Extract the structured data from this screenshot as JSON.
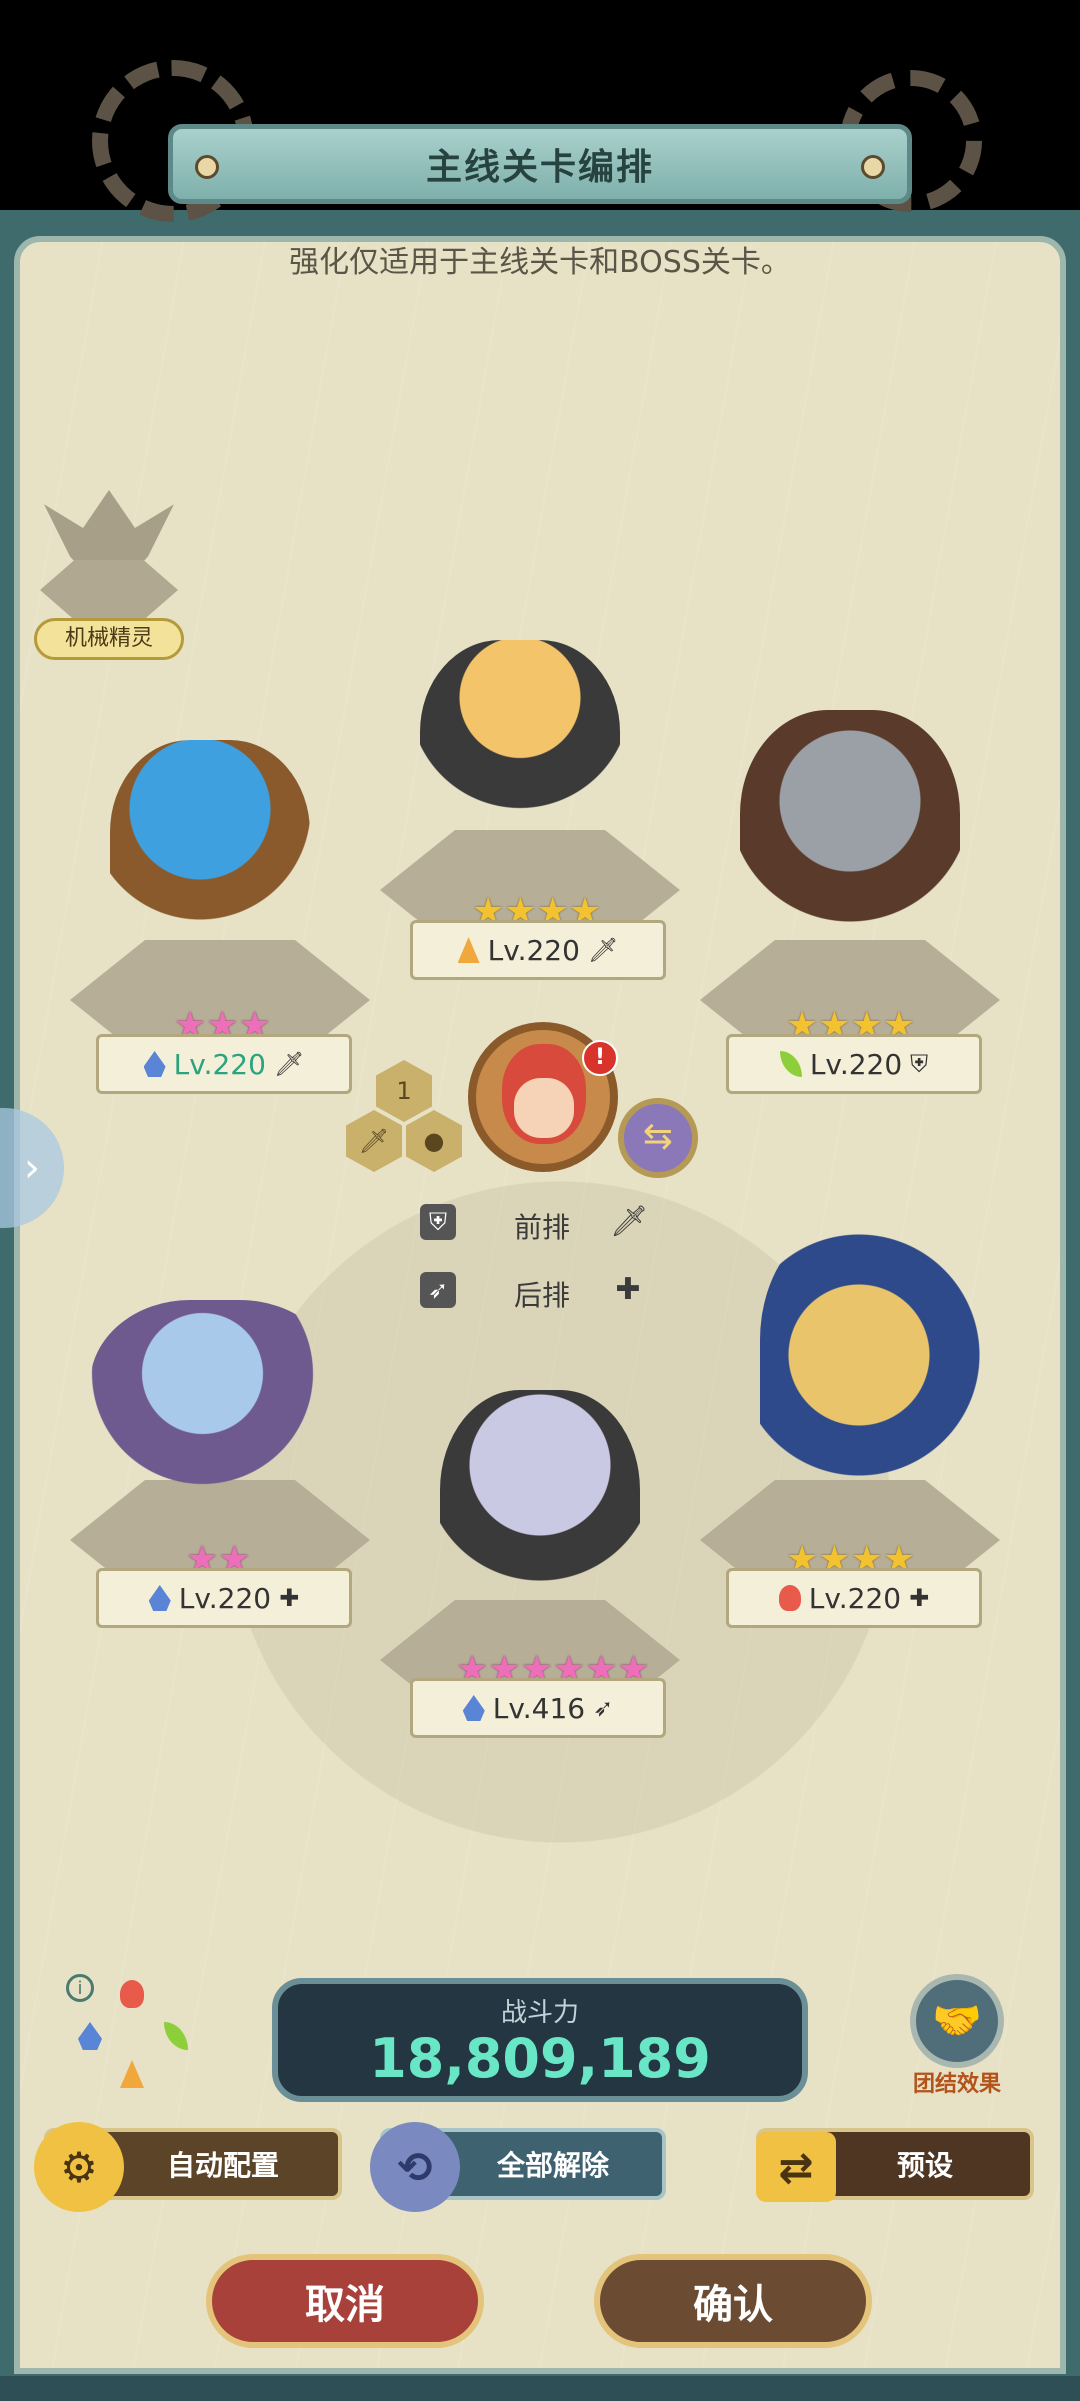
{
  "header": {
    "title": "主线关卡编排",
    "subtitle": "强化仅适用于主线关卡和BOSS关卡。"
  },
  "spirit": {
    "label": "机械精灵"
  },
  "formation": {
    "front_label": "前排",
    "back_label": "后排",
    "leader_slot": "1"
  },
  "heroes": [
    {
      "id": "top-center",
      "stars": 4,
      "star_color": "gold",
      "element": "earth",
      "level": "Lv.220",
      "role": "sword"
    },
    {
      "id": "left-front",
      "stars": 3,
      "star_color": "pink",
      "element": "water",
      "level": "Lv.220",
      "role": "sword"
    },
    {
      "id": "right-front",
      "stars": 4,
      "star_color": "gold",
      "element": "wind",
      "level": "Lv.220",
      "role": "shield"
    },
    {
      "id": "left-back",
      "stars": 2,
      "star_color": "pink",
      "element": "water",
      "level": "Lv.220",
      "role": "heal"
    },
    {
      "id": "right-back",
      "stars": 4,
      "star_color": "gold",
      "element": "fire",
      "level": "Lv.220",
      "role": "heal"
    },
    {
      "id": "bottom-center",
      "stars": 6,
      "star_color": "pink",
      "element": "water",
      "level": "Lv.416",
      "role": "archer"
    }
  ],
  "power": {
    "label": "战斗力",
    "value": "18,809,189"
  },
  "team_effect": {
    "label": "团结效果"
  },
  "buttons": {
    "auto": "自动配置",
    "clear": "全部解除",
    "preset": "预设",
    "cancel": "取消",
    "confirm": "确认"
  },
  "colors": {
    "accent": "#69e6c6",
    "panel": "#e7e1c6",
    "frame": "#3f6b6c"
  }
}
